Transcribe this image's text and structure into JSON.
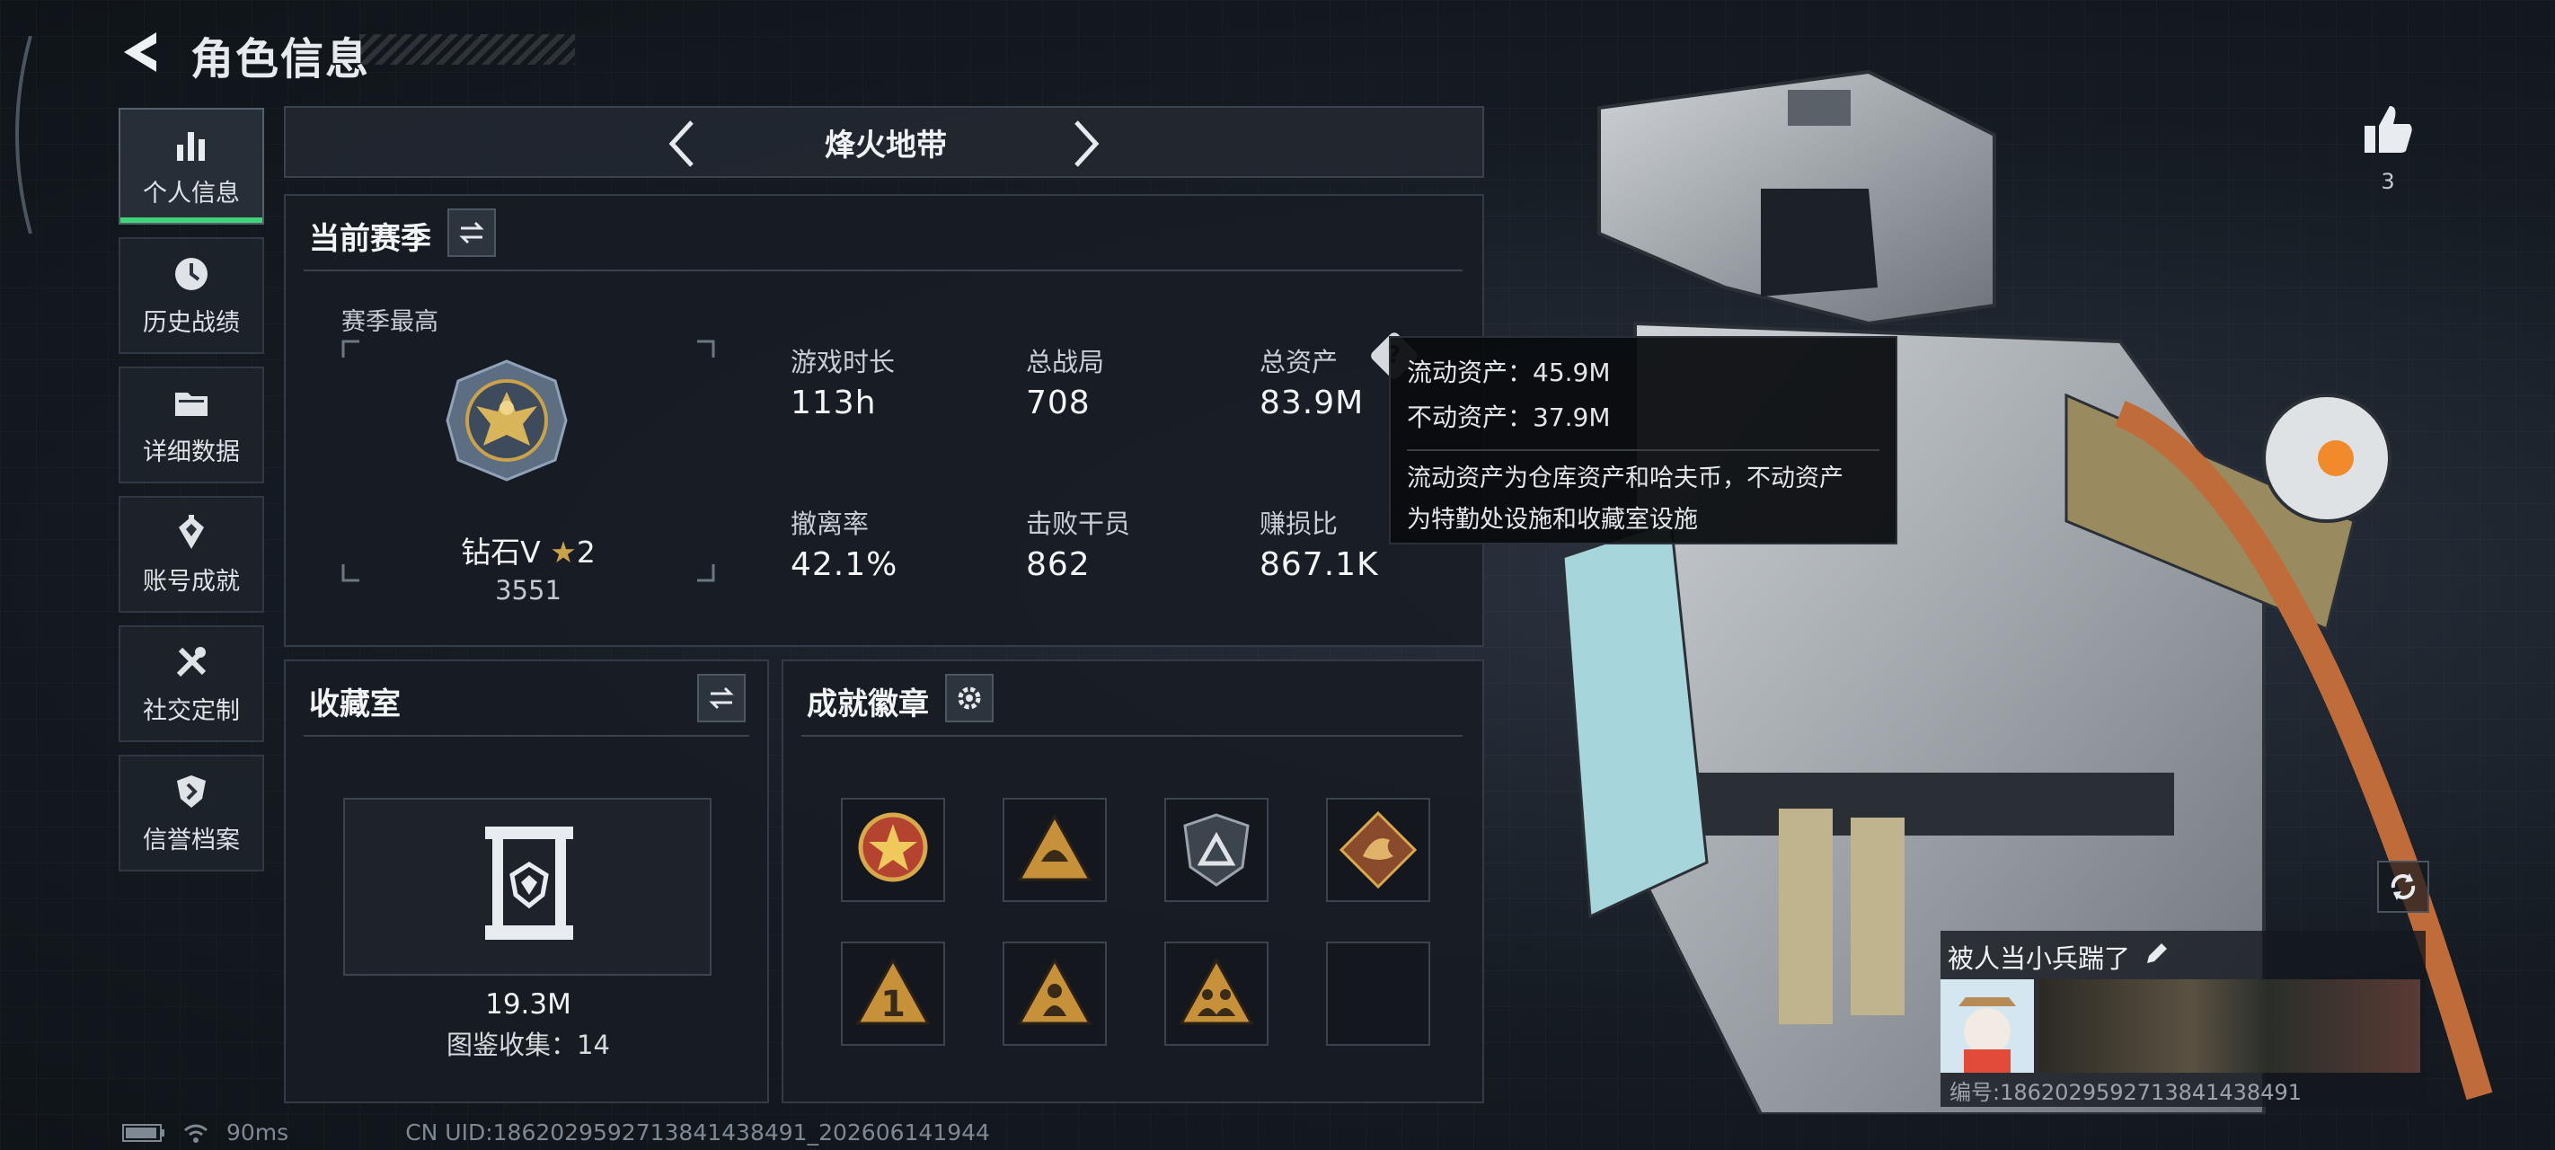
{
  "header": {
    "title": "角色信息"
  },
  "sidebar": {
    "items": [
      {
        "label": "个人信息",
        "icon": "bar-chart-icon",
        "active": true
      },
      {
        "label": "历史战绩",
        "icon": "clock-icon",
        "active": false
      },
      {
        "label": "详细数据",
        "icon": "folder-icon",
        "active": false
      },
      {
        "label": "账号成就",
        "icon": "achievement-icon",
        "active": false
      },
      {
        "label": "社交定制",
        "icon": "tools-icon",
        "active": false
      },
      {
        "label": "信誉档案",
        "icon": "shield-icon",
        "active": false
      }
    ]
  },
  "mode": {
    "title": "烽火地带"
  },
  "season": {
    "title": "当前赛季",
    "best_label": "赛季最高",
    "rank_name": "钻石V",
    "rank_stars": "2",
    "rank_score": "3551",
    "stats": [
      {
        "label": "游戏时长",
        "value": "113h"
      },
      {
        "label": "总战局",
        "value": "708"
      },
      {
        "label": "总资产",
        "value": "83.9M"
      },
      {
        "label": "撤离率",
        "value": "42.1%"
      },
      {
        "label": "击败干员",
        "value": "862"
      },
      {
        "label": "赚损比",
        "value": "867.1K"
      }
    ]
  },
  "tooltip": {
    "liquid": "流动资产：45.9M",
    "fixed": "不动资产：37.9M",
    "desc_line1": "流动资产为仓库资产和哈夫币，不动资产",
    "desc_line2": "为特勤处设施和收藏室设施"
  },
  "collection": {
    "title": "收藏室",
    "value": "19.3M",
    "catalog": "图鉴收集：14"
  },
  "achievements": {
    "title": "成就徽章",
    "badges": [
      "star-medal-icon",
      "helmet-triangle-icon",
      "mountain-shield-icon",
      "dragon-diamond-icon",
      "number-one-triangle-icon",
      "soldier-triangle-icon",
      "squad-triangle-icon",
      "empty-slot"
    ]
  },
  "social": {
    "likes": "3",
    "signature": "被人当小兵踹了",
    "player_id": "编号:1862029592713841438491"
  },
  "status": {
    "ping": "90ms",
    "uid": "CN UID:1862029592713841438491_202606141944"
  },
  "colors": {
    "accent": "#3fd47a",
    "panel": "#181d24",
    "gold": "#c9a24a"
  }
}
